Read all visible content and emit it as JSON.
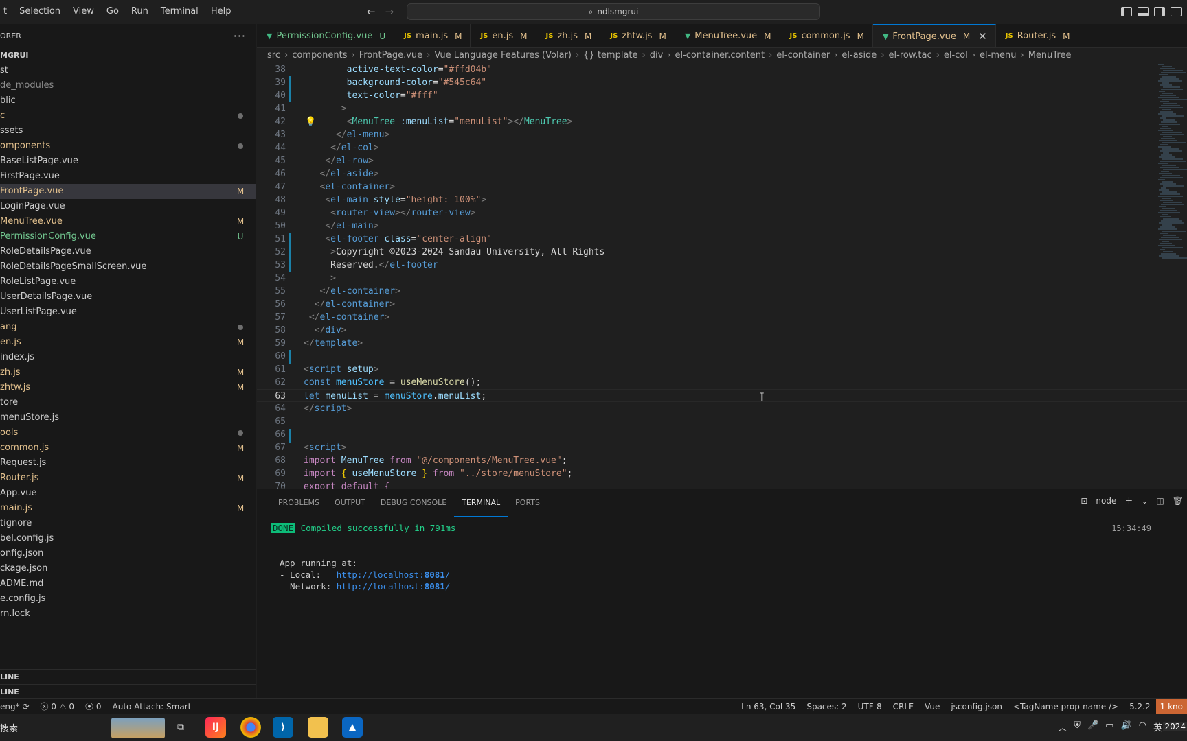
{
  "menu": [
    "t",
    "Selection",
    "View",
    "Go",
    "Run",
    "Terminal",
    "Help"
  ],
  "command_center": {
    "text": "ndlsmgrui"
  },
  "sidebar": {
    "header": "ORER",
    "root": "MGRUI",
    "items": [
      {
        "label": "st",
        "badge": ""
      },
      {
        "label": "de_modules",
        "badge": "",
        "dim": true
      },
      {
        "label": "blic",
        "badge": ""
      },
      {
        "label": "c",
        "badge": "dot",
        "color": "#e2c08d"
      },
      {
        "label": "ssets",
        "badge": ""
      },
      {
        "label": "omponents",
        "badge": "dot",
        "color": "#e2c08d"
      },
      {
        "label": "BaseListPage.vue",
        "badge": ""
      },
      {
        "label": "FirstPage.vue",
        "badge": ""
      },
      {
        "label": "FrontPage.vue",
        "badge": "M",
        "color": "#e2c08d",
        "selected": true
      },
      {
        "label": "LoginPage.vue",
        "badge": ""
      },
      {
        "label": "MenuTree.vue",
        "badge": "M",
        "color": "#e2c08d"
      },
      {
        "label": "PermissionConfig.vue",
        "badge": "U",
        "color": "#73c991"
      },
      {
        "label": "RoleDetailsPage.vue",
        "badge": ""
      },
      {
        "label": "RoleDetailsPageSmallScreen.vue",
        "badge": ""
      },
      {
        "label": "RoleListPage.vue",
        "badge": ""
      },
      {
        "label": "UserDetailsPage.vue",
        "badge": ""
      },
      {
        "label": "UserListPage.vue",
        "badge": ""
      },
      {
        "label": "ang",
        "badge": "dot",
        "color": "#e2c08d"
      },
      {
        "label": "en.js",
        "badge": "M",
        "color": "#e2c08d"
      },
      {
        "label": "index.js",
        "badge": ""
      },
      {
        "label": "zh.js",
        "badge": "M",
        "color": "#e2c08d"
      },
      {
        "label": "zhtw.js",
        "badge": "M",
        "color": "#e2c08d"
      },
      {
        "label": "tore",
        "badge": ""
      },
      {
        "label": "menuStore.js",
        "badge": ""
      },
      {
        "label": "ools",
        "badge": "dot",
        "color": "#e2c08d"
      },
      {
        "label": "common.js",
        "badge": "M",
        "color": "#e2c08d"
      },
      {
        "label": "Request.js",
        "badge": ""
      },
      {
        "label": "Router.js",
        "badge": "M",
        "color": "#e2c08d"
      },
      {
        "label": "App.vue",
        "badge": ""
      },
      {
        "label": "main.js",
        "badge": "M",
        "color": "#e2c08d"
      },
      {
        "label": "tignore",
        "badge": ""
      },
      {
        "label": "bel.config.js",
        "badge": ""
      },
      {
        "label": "onfig.json",
        "badge": ""
      },
      {
        "label": "ckage.json",
        "badge": ""
      },
      {
        "label": "ADME.md",
        "badge": ""
      },
      {
        "label": "e.config.js",
        "badge": ""
      },
      {
        "label": "rn.lock",
        "badge": ""
      }
    ],
    "sections": [
      "LINE",
      "LINE"
    ]
  },
  "tabs": [
    {
      "label": "PermissionConfig.vue",
      "status": "U",
      "kind": "vue",
      "color": "#73c991"
    },
    {
      "label": "main.js",
      "status": "M",
      "kind": "js",
      "color": "#e2c08d"
    },
    {
      "label": "en.js",
      "status": "M",
      "kind": "js",
      "color": "#e2c08d"
    },
    {
      "label": "zh.js",
      "status": "M",
      "kind": "js",
      "color": "#e2c08d"
    },
    {
      "label": "zhtw.js",
      "status": "M",
      "kind": "js",
      "color": "#e2c08d"
    },
    {
      "label": "MenuTree.vue",
      "status": "M",
      "kind": "vue",
      "color": "#e2c08d"
    },
    {
      "label": "common.js",
      "status": "M",
      "kind": "js",
      "color": "#e2c08d"
    },
    {
      "label": "FrontPage.vue",
      "status": "M",
      "kind": "vue",
      "color": "#e2c08d",
      "active": true
    },
    {
      "label": "Router.js",
      "status": "M",
      "kind": "js",
      "color": "#e2c08d"
    }
  ],
  "breadcrumb": [
    "src",
    "components",
    "FrontPage.vue",
    "Vue Language Features (Volar)",
    "{} template",
    "div",
    "el-container.content",
    "el-container",
    "el-aside",
    "el-row.tac",
    "el-col",
    "el-menu",
    "MenuTree"
  ],
  "code": [
    {
      "n": "38",
      "parts": [
        [
          "        ",
          ""
        ],
        [
          "active-text-color",
          "t-attr"
        ],
        [
          "=",
          "t-op"
        ],
        [
          "\"#ffd04b\"",
          "t-str"
        ]
      ]
    },
    {
      "n": "39",
      "parts": [
        [
          "        ",
          ""
        ],
        [
          "background-color",
          "t-attr"
        ],
        [
          "=",
          "t-op"
        ],
        [
          "\"#545c64\"",
          "t-str"
        ]
      ]
    },
    {
      "n": "40",
      "parts": [
        [
          "        ",
          ""
        ],
        [
          "text-color",
          "t-attr"
        ],
        [
          "=",
          "t-op"
        ],
        [
          "\"#fff\"",
          "t-str"
        ]
      ]
    },
    {
      "n": "41",
      "parts": [
        [
          "       ",
          ""
        ],
        [
          ">",
          "t-brk"
        ]
      ]
    },
    {
      "n": "42",
      "parts": [
        [
          "        ",
          ""
        ],
        [
          "<",
          "t-brk"
        ],
        [
          "MenuTree",
          "t-cmp"
        ],
        [
          " :menuList",
          "t-attr"
        ],
        [
          "=",
          "t-op"
        ],
        [
          "\"menuList\"",
          "t-str"
        ],
        [
          "></",
          "t-brk"
        ],
        [
          "MenuTree",
          "t-cmp"
        ],
        [
          ">",
          "t-brk"
        ]
      ]
    },
    {
      "n": "43",
      "parts": [
        [
          "      ",
          ""
        ],
        [
          "</",
          "t-brk"
        ],
        [
          "el-menu",
          "t-tag"
        ],
        [
          ">",
          "t-brk"
        ]
      ]
    },
    {
      "n": "44",
      "parts": [
        [
          "     ",
          ""
        ],
        [
          "</",
          "t-brk"
        ],
        [
          "el-col",
          "t-tag"
        ],
        [
          ">",
          "t-brk"
        ]
      ]
    },
    {
      "n": "45",
      "parts": [
        [
          "    ",
          ""
        ],
        [
          "</",
          "t-brk"
        ],
        [
          "el-row",
          "t-tag"
        ],
        [
          ">",
          "t-brk"
        ]
      ]
    },
    {
      "n": "46",
      "parts": [
        [
          "   ",
          ""
        ],
        [
          "</",
          "t-brk"
        ],
        [
          "el-aside",
          "t-tag"
        ],
        [
          ">",
          "t-brk"
        ]
      ]
    },
    {
      "n": "47",
      "parts": [
        [
          "   ",
          ""
        ],
        [
          "<",
          "t-brk"
        ],
        [
          "el-container",
          "t-tag"
        ],
        [
          ">",
          "t-brk"
        ]
      ]
    },
    {
      "n": "48",
      "parts": [
        [
          "    ",
          ""
        ],
        [
          "<",
          "t-brk"
        ],
        [
          "el-main",
          "t-tag"
        ],
        [
          " style",
          "t-attr"
        ],
        [
          "=",
          "t-op"
        ],
        [
          "\"height: 100%\"",
          "t-str"
        ],
        [
          ">",
          "t-brk"
        ]
      ]
    },
    {
      "n": "49",
      "parts": [
        [
          "     ",
          ""
        ],
        [
          "<",
          "t-brk"
        ],
        [
          "router-view",
          "t-tag"
        ],
        [
          "></",
          "t-brk"
        ],
        [
          "router-view",
          "t-tag"
        ],
        [
          ">",
          "t-brk"
        ]
      ]
    },
    {
      "n": "50",
      "parts": [
        [
          "    ",
          ""
        ],
        [
          "</",
          "t-brk"
        ],
        [
          "el-main",
          "t-tag"
        ],
        [
          ">",
          "t-brk"
        ]
      ]
    },
    {
      "n": "51",
      "parts": [
        [
          "    ",
          ""
        ],
        [
          "<",
          "t-brk"
        ],
        [
          "el-footer",
          "t-tag"
        ],
        [
          " class",
          "t-attr"
        ],
        [
          "=",
          "t-op"
        ],
        [
          "\"center-align\"",
          "t-str"
        ]
      ]
    },
    {
      "n": "52",
      "parts": [
        [
          "     ",
          ""
        ],
        [
          ">",
          "t-brk"
        ],
        [
          "Copyright ©2023-2024 Sandau University, All Rights",
          "t-txt"
        ]
      ]
    },
    {
      "n": "53",
      "parts": [
        [
          "     ",
          ""
        ],
        [
          "Reserved.",
          "t-txt"
        ],
        [
          "</",
          "t-brk"
        ],
        [
          "el-footer",
          "t-tag"
        ]
      ]
    },
    {
      "n": "54",
      "parts": [
        [
          "     ",
          ""
        ],
        [
          ">",
          "t-brk"
        ]
      ]
    },
    {
      "n": "55",
      "parts": [
        [
          "   ",
          ""
        ],
        [
          "</",
          "t-brk"
        ],
        [
          "el-container",
          "t-tag"
        ],
        [
          ">",
          "t-brk"
        ]
      ]
    },
    {
      "n": "56",
      "parts": [
        [
          "  ",
          ""
        ],
        [
          "</",
          "t-brk"
        ],
        [
          "el-container",
          "t-tag"
        ],
        [
          ">",
          "t-brk"
        ]
      ]
    },
    {
      "n": "57",
      "parts": [
        [
          " ",
          ""
        ],
        [
          "</",
          "t-brk"
        ],
        [
          "el-container",
          "t-tag"
        ],
        [
          ">",
          "t-brk"
        ]
      ]
    },
    {
      "n": "58",
      "parts": [
        [
          "  ",
          ""
        ],
        [
          "</",
          "t-brk"
        ],
        [
          "div",
          "t-tag"
        ],
        [
          ">",
          "t-brk"
        ]
      ]
    },
    {
      "n": "59",
      "parts": [
        [
          "",
          ""
        ],
        [
          "</",
          "t-brk"
        ],
        [
          "template",
          "t-tag"
        ],
        [
          ">",
          "t-brk"
        ]
      ]
    },
    {
      "n": "60",
      "parts": [
        [
          "",
          ""
        ]
      ]
    },
    {
      "n": "61",
      "parts": [
        [
          "",
          ""
        ],
        [
          "<",
          "t-brk"
        ],
        [
          "script",
          "t-tag"
        ],
        [
          " setup",
          "t-attr"
        ],
        [
          ">",
          "t-brk"
        ]
      ]
    },
    {
      "n": "62",
      "parts": [
        [
          "",
          ""
        ],
        [
          "const",
          "t-kw"
        ],
        [
          " ",
          ""
        ],
        [
          "menuStore",
          "t-const"
        ],
        [
          " = ",
          "t-op"
        ],
        [
          "useMenuStore",
          "t-fn"
        ],
        [
          "();",
          "t-op"
        ]
      ]
    },
    {
      "n": "63",
      "parts": [
        [
          "",
          ""
        ],
        [
          "let",
          "t-kw"
        ],
        [
          " ",
          ""
        ],
        [
          "menuList",
          "t-var"
        ],
        [
          " = ",
          "t-op"
        ],
        [
          "menuStore",
          "t-const"
        ],
        [
          ".",
          "t-op"
        ],
        [
          "menuList",
          "t-var"
        ],
        [
          ";",
          "t-op"
        ]
      ],
      "cur": true
    },
    {
      "n": "64",
      "parts": [
        [
          "",
          ""
        ],
        [
          "</",
          "t-brk"
        ],
        [
          "script",
          "t-tag"
        ],
        [
          ">",
          "t-brk"
        ]
      ]
    },
    {
      "n": "65",
      "parts": [
        [
          "",
          ""
        ]
      ]
    },
    {
      "n": "66",
      "parts": [
        [
          "",
          ""
        ]
      ]
    },
    {
      "n": "67",
      "parts": [
        [
          "",
          ""
        ],
        [
          "<",
          "t-brk"
        ],
        [
          "script",
          "t-tag"
        ],
        [
          ">",
          "t-brk"
        ]
      ]
    },
    {
      "n": "68",
      "parts": [
        [
          "",
          ""
        ],
        [
          "import",
          "t-kw2"
        ],
        [
          " ",
          ""
        ],
        [
          "MenuTree",
          "t-var"
        ],
        [
          " from ",
          "t-kw2"
        ],
        [
          "\"@/components/MenuTree.vue\"",
          "t-str"
        ],
        [
          ";",
          "t-op"
        ]
      ]
    },
    {
      "n": "69",
      "parts": [
        [
          "",
          ""
        ],
        [
          "import",
          "t-kw2"
        ],
        [
          " { ",
          "t-yel"
        ],
        [
          "useMenuStore",
          "t-var"
        ],
        [
          " } ",
          "t-yel"
        ],
        [
          "from ",
          "t-kw2"
        ],
        [
          "\"../store/menuStore\"",
          "t-str"
        ],
        [
          ";",
          "t-op"
        ]
      ]
    },
    {
      "n": "70",
      "parts": [
        [
          "",
          ""
        ],
        [
          "export default {",
          "t-kw2"
        ]
      ]
    }
  ],
  "panel": {
    "tabs": [
      "PROBLEMS",
      "OUTPUT",
      "DEBUG CONSOLE",
      "TERMINAL",
      "PORTS"
    ],
    "active_tab": "TERMINAL",
    "shell": "node",
    "time": "15:34:49",
    "done_badge": "DONE",
    "compiled": "Compiled successfully in 791ms",
    "app_running": "App running at:",
    "local_label": "- Local:   ",
    "local_url_pre": "http://localhost:",
    "local_port": "8081",
    "local_url_post": "/",
    "network_label": "- Network: ",
    "network_url_pre": "http://localhost:",
    "network_port": "8081",
    "network_url_post": "/"
  },
  "status": {
    "branch": "eng*",
    "problems": "0",
    "warnings": "0",
    "ports": "0",
    "auto_attach": "Auto Attach: Smart",
    "position": "Ln 63, Col 35",
    "spaces": "Spaces: 2",
    "encoding": "UTF-8",
    "eol": "CRLF",
    "language": "Vue",
    "config": "jsconfig.json",
    "tagname": "<TagName prop-name />",
    "version": "5.2.2",
    "last": "1 kno"
  },
  "taskbar": {
    "search_text": "搜索",
    "tray_lang": "英",
    "clock_stub": "2024"
  },
  "colors": {
    "accent": "#0078d4",
    "modified": "#e2c08d",
    "untracked": "#73c991"
  }
}
